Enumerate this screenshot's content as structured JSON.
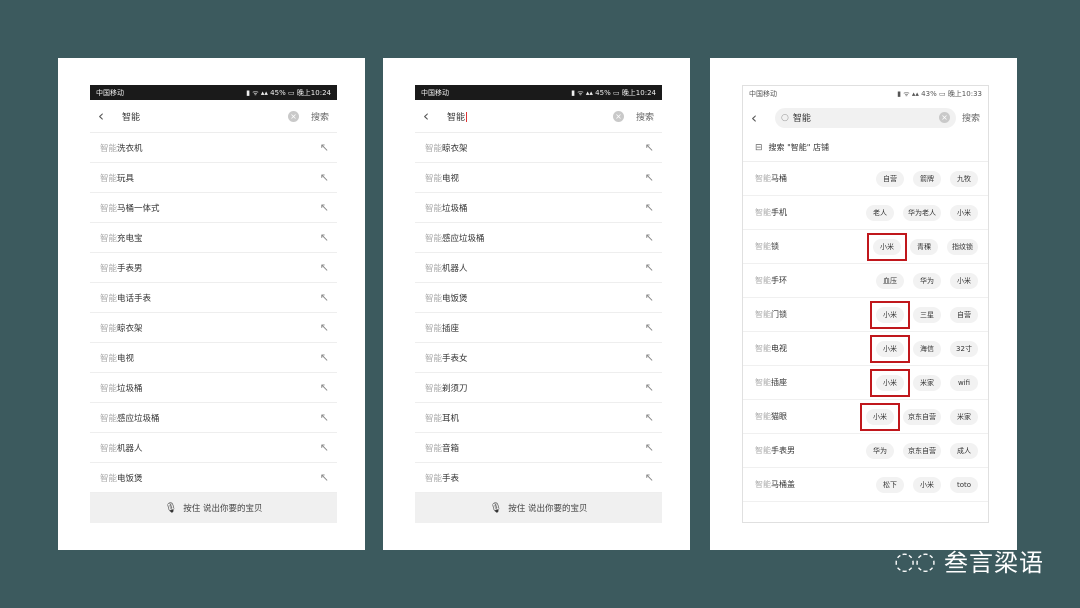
{
  "panel1": {
    "status": {
      "carrier": "中国移动",
      "battery": "45%",
      "time": "晚上10:24"
    },
    "query": "智能",
    "search_label": "搜索",
    "prefix": "智能",
    "items": [
      "洗衣机",
      "玩具",
      "马桶一体式",
      "充电宝",
      "手表男",
      "电话手表",
      "晾衣架",
      "电视",
      "垃圾桶",
      "感应垃圾桶",
      "机器人",
      "电饭煲"
    ],
    "voice_label": "按住 说出你要的宝贝"
  },
  "panel2": {
    "status": {
      "carrier": "中国移动",
      "battery": "45%",
      "time": "晚上10:24"
    },
    "query": "智能",
    "search_label": "搜索",
    "prefix": "智能",
    "items": [
      "晾衣架",
      "电视",
      "垃圾桶",
      "感应垃圾桶",
      "机器人",
      "电饭煲",
      "插座",
      "手表女",
      "剃须刀",
      "耳机",
      "音箱",
      "手表"
    ],
    "voice_label": "按住 说出你要的宝贝"
  },
  "panel3": {
    "status": {
      "carrier": "中国移动",
      "battery": "43%",
      "time": "晚上10:33"
    },
    "query": "智能",
    "search_label": "搜索",
    "shop_label": "搜索 \"智能\" 店铺",
    "prefix": "智能",
    "rows": [
      {
        "term": "马桶",
        "tags": [
          "自营",
          "箭牌",
          "九牧"
        ],
        "highlight": -1
      },
      {
        "term": "手机",
        "tags": [
          "老人",
          "华为老人",
          "小米"
        ],
        "highlight": -1
      },
      {
        "term": "锁",
        "tags": [
          "小米",
          "青稞",
          "指纹锁"
        ],
        "highlight": 0
      },
      {
        "term": "手环",
        "tags": [
          "血压",
          "华为",
          "小米"
        ],
        "highlight": -1
      },
      {
        "term": "门锁",
        "tags": [
          "小米",
          "三星",
          "自营"
        ],
        "highlight": 0
      },
      {
        "term": "电视",
        "tags": [
          "小米",
          "海信",
          "32寸"
        ],
        "highlight": 0
      },
      {
        "term": "插座",
        "tags": [
          "小米",
          "米家",
          "wifi"
        ],
        "highlight": 0
      },
      {
        "term": "猫眼",
        "tags": [
          "小米",
          "京东自营",
          "米家"
        ],
        "highlight": 0
      },
      {
        "term": "手表男",
        "tags": [
          "华为",
          "京东自营",
          "成人"
        ],
        "highlight": -1
      },
      {
        "term": "马桶盖",
        "tags": [
          "松下",
          "小米",
          "toto"
        ],
        "highlight": -1
      }
    ]
  },
  "watermark": {
    "text": "叁言梁语"
  },
  "icons": {
    "back": "chevron-left-icon",
    "clear": "clear-icon",
    "arrow": "arrow-up-left-icon",
    "mic": "microphone-icon",
    "search": "search-icon",
    "shop": "shop-icon",
    "wechat": "wechat-icon"
  },
  "colors": {
    "background": "#3c5a5e",
    "highlight": "#c0171c"
  }
}
